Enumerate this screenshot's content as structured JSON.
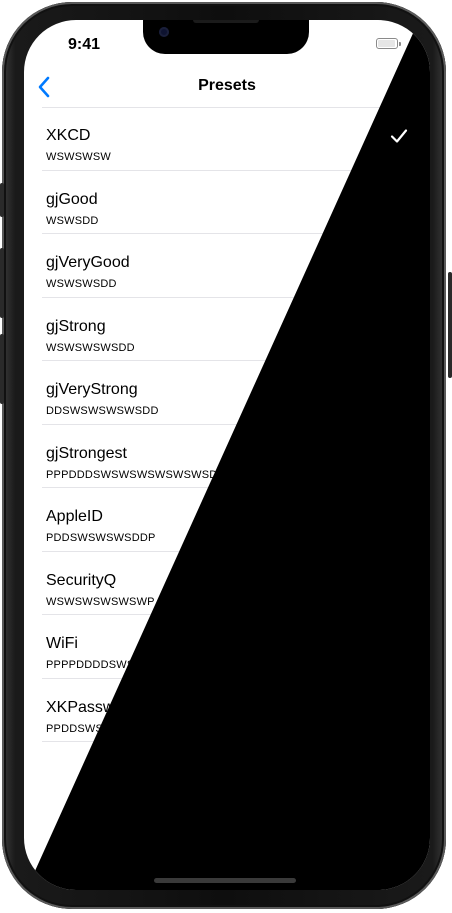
{
  "status_bar": {
    "time": "9:41"
  },
  "nav": {
    "title": "Presets"
  },
  "presets": [
    {
      "name": "XKCD",
      "pattern": "WSWSWSW",
      "selected": true
    },
    {
      "name": "gjGood",
      "pattern": "WSWSDD"
    },
    {
      "name": "gjVeryGood",
      "pattern": "WSWSWSDD"
    },
    {
      "name": "gjStrong",
      "pattern": "WSWSWSWSDD"
    },
    {
      "name": "gjVeryStrong",
      "pattern": "DDSWSWSWSWSDD"
    },
    {
      "name": "gjStrongest",
      "pattern": "PPPDDDSWSWSWSWSWSWSDDDPPP"
    },
    {
      "name": "AppleID",
      "pattern": "PDDSWSWSWSDDP"
    },
    {
      "name": "SecurityQ",
      "pattern": "WSWSWSWSWSWP"
    },
    {
      "name": "WiFi",
      "pattern": "PPPPDDDDSWSWSWSWSWSWSDDDDPPPP"
    },
    {
      "name": "XKPasswd",
      "pattern": "PPDDSWSWSWSDDPP"
    }
  ],
  "colors": {
    "accent": "#007AFF",
    "background": "#FFFFFF",
    "text": "#000000"
  },
  "icons": {
    "back": "chevron-left-icon",
    "check": "checkmark-icon",
    "wifi": "wifi-icon",
    "battery": "battery-icon"
  }
}
